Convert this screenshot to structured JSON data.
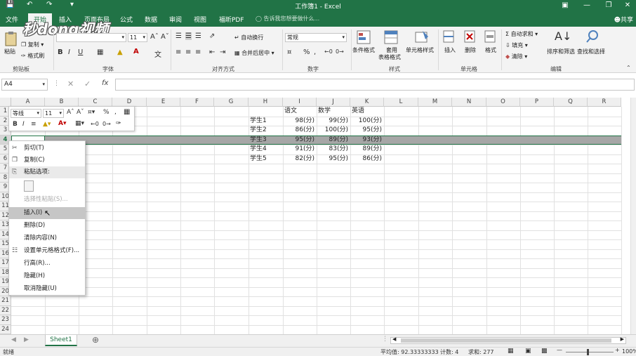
{
  "window": {
    "title": "工作簿1 - Excel",
    "share_label": "共享",
    "tell_me": "告诉我您想要做什么..."
  },
  "tabs": [
    {
      "label": "文件",
      "active": false
    },
    {
      "label": "开始",
      "active": true
    },
    {
      "label": "插入",
      "active": false
    },
    {
      "label": "页面布局",
      "active": false
    },
    {
      "label": "公式",
      "active": false
    },
    {
      "label": "数据",
      "active": false
    },
    {
      "label": "审阅",
      "active": false
    },
    {
      "label": "视图",
      "active": false
    },
    {
      "label": "福昕PDF",
      "active": false
    }
  ],
  "watermark": "秒dong视频",
  "ribbon": {
    "clipboard": {
      "label": "剪贴板",
      "paste": "粘贴",
      "copy": "复制",
      "format_painter": "格式刷"
    },
    "font": {
      "label": "字体",
      "size": "11"
    },
    "alignment": {
      "label": "对齐方式",
      "wrap": "自动换行",
      "merge": "合并后居中"
    },
    "number": {
      "label": "数字",
      "format": "常规"
    },
    "styles": {
      "label": "样式",
      "cond": "条件格式",
      "table1": "套用",
      "table2": "表格格式",
      "cell": "单元格样式"
    },
    "cells": {
      "label": "单元格",
      "insert": "插入",
      "delete": "删除",
      "format": "格式"
    },
    "editing": {
      "label": "编辑",
      "autosum": "自动求和",
      "fill": "填充",
      "clear": "清除",
      "sort": "排序和筛选",
      "find": "查找和选择"
    }
  },
  "formula": {
    "namebox": "A4",
    "fx": "fx"
  },
  "columns": [
    "A",
    "B",
    "C",
    "D",
    "E",
    "F",
    "G",
    "H",
    "I",
    "J",
    "K",
    "L",
    "M",
    "N",
    "O",
    "P",
    "Q",
    "R"
  ],
  "rows": [
    "1",
    "2",
    "3",
    "4",
    "5",
    "6",
    "7",
    "8",
    "9",
    "10",
    "11",
    "12",
    "13",
    "14",
    "15",
    "16",
    "17",
    "18",
    "19",
    "20",
    "21",
    "22",
    "23",
    "24"
  ],
  "table": {
    "headers": [
      "语文",
      "数学",
      "英语"
    ],
    "rows": [
      {
        "name": "学生1",
        "vals": [
          "98(分)",
          "99(分)",
          "100(分)"
        ]
      },
      {
        "name": "学生2",
        "vals": [
          "86(分)",
          "100(分)",
          "95(分)"
        ]
      },
      {
        "name": "学生3",
        "vals": [
          "95(分)",
          "89(分)",
          "93(分)"
        ]
      },
      {
        "name": "学生4",
        "vals": [
          "91(分)",
          "83(分)",
          "89(分)"
        ]
      },
      {
        "name": "学生5",
        "vals": [
          "82(分)",
          "95(分)",
          "86(分)"
        ]
      }
    ]
  },
  "mini_toolbar": {
    "font": "等线",
    "size": "11"
  },
  "context_menu": [
    {
      "label": "剪切(T)",
      "icon": "scissors-icon",
      "kind": "normal"
    },
    {
      "label": "复制(C)",
      "icon": "copy-icon",
      "kind": "normal"
    },
    {
      "label": "粘贴选项:",
      "icon": "paste-icon",
      "kind": "section"
    },
    {
      "label": "",
      "icon": "clipboard-icon",
      "kind": "paste-icons"
    },
    {
      "label": "选择性粘贴(S)...",
      "icon": "",
      "kind": "disabled"
    },
    {
      "label": "插入(I)",
      "icon": "",
      "kind": "highlight"
    },
    {
      "label": "删除(D)",
      "icon": "",
      "kind": "normal"
    },
    {
      "label": "清除内容(N)",
      "icon": "",
      "kind": "normal"
    },
    {
      "label": "设置单元格格式(F)...",
      "icon": "format-cells-icon",
      "kind": "normal"
    },
    {
      "label": "行高(R)...",
      "icon": "",
      "kind": "normal"
    },
    {
      "label": "隐藏(H)",
      "icon": "",
      "kind": "normal"
    },
    {
      "label": "取消隐藏(U)",
      "icon": "",
      "kind": "normal"
    }
  ],
  "sheet": {
    "name": "Sheet1"
  },
  "status": {
    "ready": "就绪",
    "average": "平均值: 92.33333333",
    "count": "计数: 4",
    "sum": "求和: 277",
    "zoom": "100%"
  },
  "colors": {
    "brand": "#217346",
    "selection": "#a6a6a6",
    "highlight": "#c6c6c6"
  }
}
